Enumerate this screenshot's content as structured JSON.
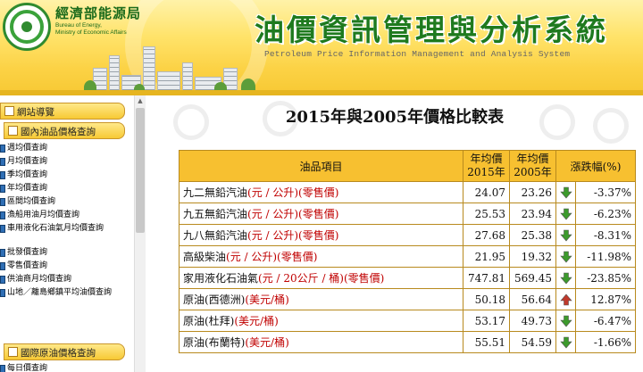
{
  "header": {
    "bureau_name": "經濟部能源局",
    "bureau_en_line1": "Bureau of Energy,",
    "bureau_en_line2": "Ministry of Economic Affairs",
    "system_title": "油價資訊管理與分析系統",
    "system_title_en": "Petroleum Price Information Management and Analysis System"
  },
  "sidebar": {
    "site_nav": "網站導覽",
    "domestic_header": "國內油品價格查詢",
    "domestic_items": [
      "週均價查詢",
      "月均價查詢",
      "季均價查詢",
      "年均價查詢",
      "區間均價查詢",
      "漁船用油月均價查詢",
      "車用液化石油氣月均價查詢",
      "批發價查詢",
      "零售價查詢",
      "供油商月均價查詢",
      "山地／離島鄉鎮平均油價查詢"
    ],
    "intl_header": "國際原油價格查詢",
    "intl_items": [
      "每日價查詢"
    ]
  },
  "main": {
    "title": "2015年與2005年價格比較表",
    "columns": {
      "item": "油品項目",
      "y2015_line1": "年均價",
      "y2015_line2": "2015年",
      "y2005_line1": "年均價",
      "y2005_line2": "2005年",
      "change": "漲跌幅(%)"
    },
    "rows": [
      {
        "name": "九二無鉛汽油",
        "unit": "(元 / 公升)(零售價)",
        "y2015": "24.07",
        "y2005": "23.26",
        "direction": "down",
        "change": "-3.37%"
      },
      {
        "name": "九五無鉛汽油",
        "unit": "(元 / 公升)(零售價)",
        "y2015": "25.53",
        "y2005": "23.94",
        "direction": "down",
        "change": "-6.23%"
      },
      {
        "name": "九八無鉛汽油",
        "unit": "(元 / 公升)(零售價)",
        "y2015": "27.68",
        "y2005": "25.38",
        "direction": "down",
        "change": "-8.31%"
      },
      {
        "name": "高級柴油",
        "unit": "(元 / 公升)(零售價)",
        "y2015": "21.95",
        "y2005": "19.32",
        "direction": "down",
        "change": "-11.98%"
      },
      {
        "name": "家用液化石油氣",
        "unit": "(元 / 20公斤 / 桶)(零售價)",
        "y2015": "747.81",
        "y2005": "569.45",
        "direction": "down",
        "change": "-23.85%"
      },
      {
        "name": "原油(西德洲)",
        "unit": "(美元/桶)",
        "y2015": "50.18",
        "y2005": "56.64",
        "direction": "up",
        "change": "12.87%"
      },
      {
        "name": "原油(杜拜)",
        "unit": "(美元/桶)",
        "y2015": "53.17",
        "y2005": "49.73",
        "direction": "down",
        "change": "-6.47%"
      },
      {
        "name": "原油(布蘭特)",
        "unit": "(美元/桶)",
        "y2015": "55.51",
        "y2005": "54.59",
        "direction": "down",
        "change": "-1.66%"
      }
    ]
  },
  "colors": {
    "header_bg": "#fcd245",
    "brand_green": "#1e7a1e",
    "table_header": "#f7c030",
    "unit_red": "#c00000",
    "arrow_down": "#3c9a2c",
    "arrow_up": "#c0392b"
  }
}
